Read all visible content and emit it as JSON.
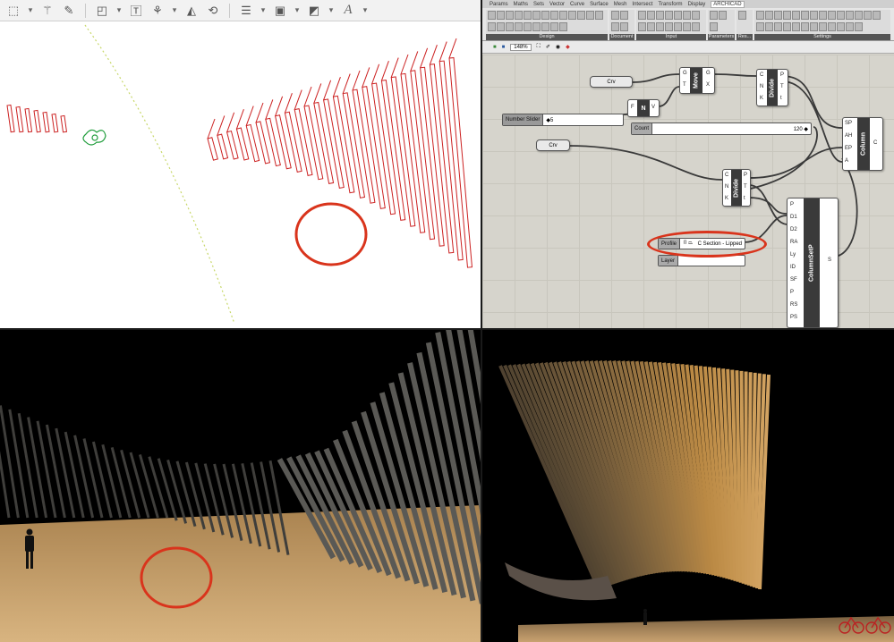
{
  "plan_view": {
    "toolbar": {
      "icons": [
        "marquee-select-icon",
        "magic-wand-icon",
        "pen-tool-icon",
        "shape-icon",
        "text-icon",
        "stamp-icon",
        "fill-icon",
        "rotate-icon",
        "line-weight-icon",
        "fill-color-icon",
        "pen-color-icon",
        "text-style-icon"
      ],
      "text_style_glyph": "A"
    },
    "annotation_color": "#d9341c"
  },
  "grasshopper": {
    "menu_tabs": [
      "Params",
      "Maths",
      "Sets",
      "Vector",
      "Curve",
      "Surface",
      "Mesh",
      "Intersect",
      "Transform",
      "Display",
      "ARCHICAD"
    ],
    "active_tab": "ARCHICAD",
    "ribbon_groups": [
      "Design",
      "Document",
      "Input",
      "Parameters",
      "Res...",
      "Settings"
    ],
    "canvas_zoom": "148%",
    "components": {
      "crv_1": "Crv",
      "crv_2": "Crv",
      "move": {
        "title": "Move",
        "inputs": [
          "G",
          "T"
        ],
        "outputs": [
          "G",
          "X"
        ]
      },
      "divide_1": {
        "title": "Divide",
        "inputs": [
          "C",
          "N",
          "K"
        ],
        "outputs": [
          "P",
          "T",
          "t"
        ]
      },
      "divide_2": {
        "title": "Divide",
        "inputs": [
          "C",
          "N",
          "K"
        ],
        "outputs": [
          "P",
          "T",
          "t"
        ]
      },
      "unit_vector": {
        "inputs": [
          "F"
        ],
        "title": "N",
        "outputs": [
          "V"
        ]
      },
      "number_slider": {
        "label": "Number Slider",
        "value": "◆5"
      },
      "count_slider": {
        "label": "Count",
        "value": "120 ◆"
      },
      "column": {
        "title": "Column",
        "inputs": [
          "SP",
          "AH",
          "EP",
          "A"
        ],
        "outputs": [
          "C"
        ]
      },
      "column_setup": {
        "title": "ColumnSetP",
        "inputs": [
          "P",
          "D1",
          "D2",
          "RA",
          "Ly",
          "ID",
          "SF",
          "P",
          "RS",
          "PS"
        ],
        "outputs": [
          "S"
        ]
      },
      "profile": {
        "label": "Profile",
        "value": "C Section - Lipped"
      },
      "layer": {
        "label": "Layer"
      }
    }
  },
  "renders": {
    "sky_color": "#000000",
    "ground_color": "#c9a270",
    "slat_color": "#4a4946"
  }
}
